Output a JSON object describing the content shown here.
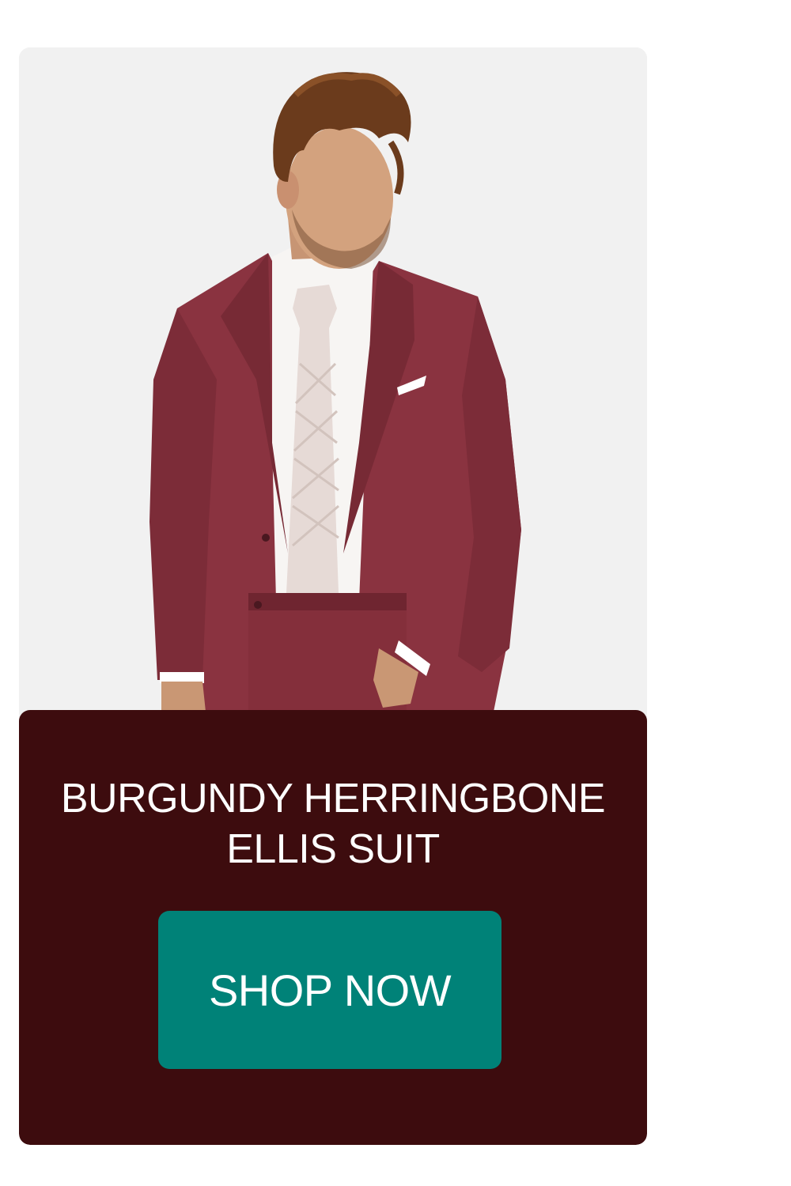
{
  "product": {
    "image_alt": "Model wearing burgundy herringbone suit with white shirt and light tie",
    "title_line1": "BURGUNDY HERRINGBONE",
    "title_line2": "ELLIS SUIT",
    "cta_label": "SHOP NOW"
  },
  "colors": {
    "page_bg": "#ffffff",
    "photo_bg": "#f1f1f1",
    "panel_bg": "#3d0c0e",
    "cta_bg": "#008278",
    "suit": "#8a3340",
    "text": "#ffffff"
  }
}
